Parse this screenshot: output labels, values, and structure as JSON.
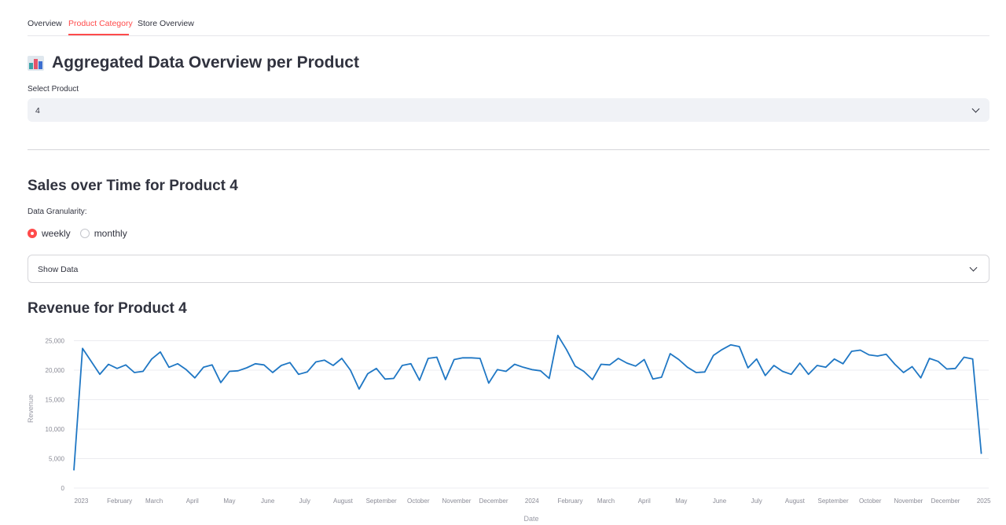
{
  "tabs": [
    "Overview",
    "Product Category",
    "Store Overview"
  ],
  "active_tab": "Product Category",
  "header": {
    "icon": "bar-chart-emoji-icon",
    "title": "Aggregated Data Overview per Product"
  },
  "product_select": {
    "label": "Select Product",
    "value": "4"
  },
  "sales_section": {
    "title": "Sales over Time for Product 4",
    "granularity_label": "Data Granularity:",
    "options": [
      "weekly",
      "monthly"
    ],
    "selected": "weekly",
    "expander_label": "Show Data"
  },
  "chart_section": {
    "title": "Revenue for Product 4"
  },
  "colors": {
    "accent": "#ff4b4b",
    "line": "#1f77c4",
    "select_bg": "#f0f2f6"
  },
  "chart_data": {
    "type": "line",
    "xlabel": "Date",
    "ylabel": "Revenue",
    "ylim": [
      0,
      26000
    ],
    "xlim": [
      "2022-12-26",
      "2025-01-05"
    ],
    "yticks": [
      0,
      5000,
      10000,
      15000,
      20000,
      25000
    ],
    "ytick_labels": [
      "0",
      "5,000",
      "10,000",
      "15,000",
      "20,000",
      "25,000"
    ],
    "xticks": [
      {
        "date": "2023-01-01",
        "label": "2023"
      },
      {
        "date": "2023-02-01",
        "label": "February"
      },
      {
        "date": "2023-03-01",
        "label": "March"
      },
      {
        "date": "2023-04-01",
        "label": "April"
      },
      {
        "date": "2023-05-01",
        "label": "May"
      },
      {
        "date": "2023-06-01",
        "label": "June"
      },
      {
        "date": "2023-07-01",
        "label": "July"
      },
      {
        "date": "2023-08-01",
        "label": "August"
      },
      {
        "date": "2023-09-01",
        "label": "September"
      },
      {
        "date": "2023-10-01",
        "label": "October"
      },
      {
        "date": "2023-11-01",
        "label": "November"
      },
      {
        "date": "2023-12-01",
        "label": "December"
      },
      {
        "date": "2024-01-01",
        "label": "2024"
      },
      {
        "date": "2024-02-01",
        "label": "February"
      },
      {
        "date": "2024-03-01",
        "label": "March"
      },
      {
        "date": "2024-04-01",
        "label": "April"
      },
      {
        "date": "2024-05-01",
        "label": "May"
      },
      {
        "date": "2024-06-01",
        "label": "June"
      },
      {
        "date": "2024-07-01",
        "label": "July"
      },
      {
        "date": "2024-08-01",
        "label": "August"
      },
      {
        "date": "2024-09-01",
        "label": "September"
      },
      {
        "date": "2024-10-01",
        "label": "October"
      },
      {
        "date": "2024-11-01",
        "label": "November"
      },
      {
        "date": "2024-12-01",
        "label": "December"
      },
      {
        "date": "2025-01-01",
        "label": "2025"
      }
    ],
    "grid": true,
    "series": [
      {
        "start": "2022-12-26",
        "interval": "weekly",
        "values": [
          3000,
          23700,
          21500,
          19300,
          21000,
          20300,
          20900,
          19600,
          19800,
          21900,
          23100,
          20500,
          21100,
          20100,
          18700,
          20500,
          20900,
          17900,
          19800,
          19900,
          20400,
          21100,
          20900,
          19600,
          20800,
          21300,
          19300,
          19700,
          21400,
          21700,
          20800,
          22000,
          20000,
          16800,
          19400,
          20300,
          18500,
          18600,
          20800,
          21100,
          18300,
          22000,
          22200,
          18400,
          21800,
          22100,
          22100,
          22000,
          17800,
          20100,
          19800,
          21000,
          20500,
          20100,
          19900,
          18600,
          25900,
          23500,
          20700,
          19800,
          18400,
          21000,
          20900,
          22000,
          21200,
          20700,
          21800,
          18500,
          18800,
          22800,
          21800,
          20500,
          19600,
          19700,
          22500,
          23500,
          24300,
          24000,
          20400,
          21900,
          19100,
          20800,
          19800,
          19300,
          21200,
          19300,
          20800,
          20500,
          21900,
          21100,
          23200,
          23400,
          22600,
          22400,
          22700,
          21000,
          19600,
          20600,
          18700,
          22000,
          21500,
          20200,
          20300,
          22200,
          21900,
          5800
        ]
      }
    ]
  }
}
